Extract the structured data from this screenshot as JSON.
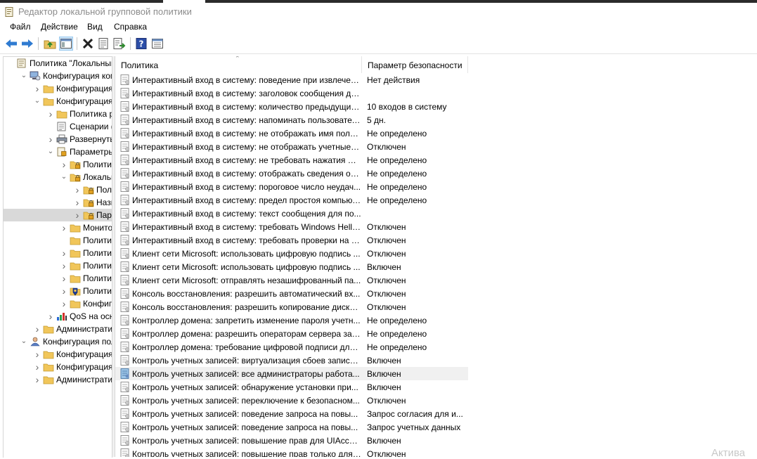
{
  "window": {
    "title": "Редактор локальной групповой политики"
  },
  "menu": {
    "file": "Файл",
    "action": "Действие",
    "view": "Вид",
    "help": "Справка"
  },
  "toolbar": [
    "back-icon",
    "forward-icon",
    "up-folder-icon",
    "show-tree-icon",
    "delete-icon",
    "properties-icon",
    "export-icon",
    "help-icon",
    "console-view-icon"
  ],
  "tree": [
    {
      "label": "Политика \"Локальный",
      "level": 0,
      "expand": "",
      "icon": "policy"
    },
    {
      "label": "Конфигурация комп",
      "level": 1,
      "expand": "open",
      "icon": "computer"
    },
    {
      "label": "Конфигурация п",
      "level": 2,
      "expand": "closed",
      "icon": "folder"
    },
    {
      "label": "Конфигурация W",
      "level": 2,
      "expand": "open",
      "icon": "folder"
    },
    {
      "label": "Политика раз",
      "level": 3,
      "expand": "closed",
      "icon": "folder"
    },
    {
      "label": "Сценарии (за",
      "level": 3,
      "expand": "",
      "icon": "script"
    },
    {
      "label": "Развернутые",
      "level": 3,
      "expand": "closed",
      "icon": "printer"
    },
    {
      "label": "Параметры б",
      "level": 3,
      "expand": "open",
      "icon": "security"
    },
    {
      "label": "Политики",
      "level": 4,
      "expand": "closed",
      "icon": "lockfolder"
    },
    {
      "label": "Локальны",
      "level": 4,
      "expand": "open",
      "icon": "lockfolder"
    },
    {
      "label": "Полит",
      "level": 5,
      "expand": "closed",
      "icon": "lockfolder"
    },
    {
      "label": "Назна",
      "level": 5,
      "expand": "closed",
      "icon": "lockfolder"
    },
    {
      "label": "Парам",
      "level": 5,
      "expand": "closed",
      "icon": "lockfolder",
      "selected": true
    },
    {
      "label": "Монитор",
      "level": 4,
      "expand": "closed",
      "icon": "folder"
    },
    {
      "label": "Политики",
      "level": 4,
      "expand": "",
      "icon": "folder"
    },
    {
      "label": "Политики",
      "level": 4,
      "expand": "closed",
      "icon": "folder"
    },
    {
      "label": "Политики",
      "level": 4,
      "expand": "closed",
      "icon": "folder"
    },
    {
      "label": "Политики",
      "level": 4,
      "expand": "closed",
      "icon": "folder"
    },
    {
      "label": "Политики",
      "level": 4,
      "expand": "closed",
      "icon": "shieldfolder"
    },
    {
      "label": "Конфигур",
      "level": 4,
      "expand": "closed",
      "icon": "folder"
    },
    {
      "label": "QoS на основ",
      "level": 3,
      "expand": "closed",
      "icon": "chart"
    },
    {
      "label": "Административ",
      "level": 2,
      "expand": "closed",
      "icon": "folder"
    },
    {
      "label": "Конфигурация поль",
      "level": 1,
      "expand": "open",
      "icon": "user"
    },
    {
      "label": "Конфигурация п",
      "level": 2,
      "expand": "closed",
      "icon": "folder"
    },
    {
      "label": "Конфигурация W",
      "level": 2,
      "expand": "closed",
      "icon": "folder"
    },
    {
      "label": "Административ",
      "level": 2,
      "expand": "closed",
      "icon": "folder"
    }
  ],
  "list": {
    "columns": {
      "policy": "Политика",
      "setting": "Параметр безопасности"
    },
    "rows": [
      {
        "name": "Интерактивный вход в систему:  поведение при извлечен...",
        "value": "Нет действия"
      },
      {
        "name": "Интерактивный вход в систему: заголовок сообщения дл...",
        "value": ""
      },
      {
        "name": "Интерактивный вход в систему: количество предыдущих ...",
        "value": "10 входов в систему"
      },
      {
        "name": "Интерактивный вход в систему: напоминать пользовател...",
        "value": "5 дн."
      },
      {
        "name": "Интерактивный вход в систему: не отображать имя поль...",
        "value": "Не определено"
      },
      {
        "name": "Интерактивный вход в систему: не отображать учетные д...",
        "value": "Отключен"
      },
      {
        "name": "Интерактивный вход в систему: не требовать нажатия CT...",
        "value": "Не определено"
      },
      {
        "name": "Интерактивный вход в систему: отображать сведения о п...",
        "value": "Не определено"
      },
      {
        "name": "Интерактивный вход в систему: пороговое число неудач...",
        "value": "Не определено"
      },
      {
        "name": "Интерактивный вход в систему: предел простоя компьют...",
        "value": "Не определено"
      },
      {
        "name": "Интерактивный вход в систему: текст сообщения для по...",
        "value": ""
      },
      {
        "name": "Интерактивный вход в систему: требовать Windows Hello...",
        "value": "Отключен"
      },
      {
        "name": "Интерактивный вход в систему: требовать проверки на к...",
        "value": "Отключен"
      },
      {
        "name": "Клиент сети Microsoft: использовать цифровую подпись ...",
        "value": "Отключен"
      },
      {
        "name": "Клиент сети Microsoft: использовать цифровую подпись ...",
        "value": "Включен"
      },
      {
        "name": "Клиент сети Microsoft: отправлять незашифрованный па...",
        "value": "Отключен"
      },
      {
        "name": "Консоль восстановления: разрешить автоматический вх...",
        "value": "Отключен"
      },
      {
        "name": "Консоль восстановления: разрешить копирование диске...",
        "value": "Отключен"
      },
      {
        "name": "Контроллер домена: запретить изменение пароля учетн...",
        "value": "Не определено"
      },
      {
        "name": "Контроллер домена: разрешить операторам сервера зад...",
        "value": "Не определено"
      },
      {
        "name": "Контроллер домена: требование цифровой подписи для ...",
        "value": "Не определено"
      },
      {
        "name": "Контроль учетных записей: виртуализация сбоев записи ...",
        "value": "Включен"
      },
      {
        "name": "Контроль учетных записей: все администраторы работа...",
        "value": "Включен",
        "highlight": true
      },
      {
        "name": "Контроль учетных записей: обнаружение установки при...",
        "value": "Включен"
      },
      {
        "name": "Контроль учетных записей: переключение к безопасном...",
        "value": "Отключен"
      },
      {
        "name": "Контроль учетных записей: поведение запроса на повы...",
        "value": "Запрос согласия для и..."
      },
      {
        "name": "Контроль учетных записей: поведение запроса на повы...",
        "value": "Запрос учетных данных"
      },
      {
        "name": "Контроль учетных записей: повышение прав для UIAcces...",
        "value": "Включен"
      },
      {
        "name": "Контроль учетных записей: повышение прав только для ...",
        "value": "Отключен"
      }
    ]
  },
  "watermark": "Актива"
}
